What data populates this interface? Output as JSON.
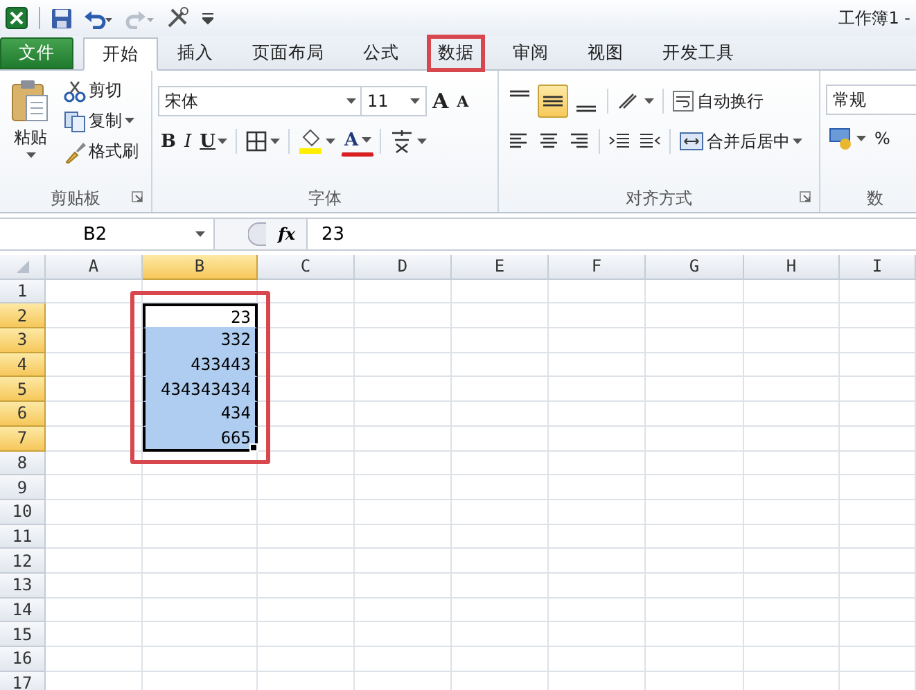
{
  "title_bar": {
    "title": "工作簿1 -"
  },
  "tabs": [
    {
      "label": "文件",
      "kind": "file",
      "selected": false,
      "highlighted": false
    },
    {
      "label": "开始",
      "kind": "tab",
      "selected": true,
      "highlighted": false
    },
    {
      "label": "插入",
      "kind": "tab",
      "selected": false,
      "highlighted": false
    },
    {
      "label": "页面布局",
      "kind": "tab",
      "selected": false,
      "highlighted": false
    },
    {
      "label": "公式",
      "kind": "tab",
      "selected": false,
      "highlighted": false
    },
    {
      "label": "数据",
      "kind": "tab",
      "selected": false,
      "highlighted": true
    },
    {
      "label": "审阅",
      "kind": "tab",
      "selected": false,
      "highlighted": false
    },
    {
      "label": "视图",
      "kind": "tab",
      "selected": false,
      "highlighted": false
    },
    {
      "label": "开发工具",
      "kind": "tab",
      "selected": false,
      "highlighted": false
    }
  ],
  "ribbon": {
    "clipboard": {
      "label": "剪贴板",
      "paste": "粘贴",
      "cut": "剪切",
      "copy": "复制",
      "format_painter": "格式刷"
    },
    "font": {
      "label": "字体",
      "font_name": "宋体",
      "font_size": "11",
      "grow": "A",
      "shrink": "A",
      "bold": "B",
      "italic": "I",
      "underline": "U",
      "font_color": "A"
    },
    "alignment": {
      "label": "对齐方式",
      "wrap_text": "自动换行",
      "merge_center": "合并后居中",
      "vertical_align": [
        {
          "selected": false
        },
        {
          "selected": true
        },
        {
          "selected": false
        }
      ]
    },
    "number": {
      "label": "数",
      "format": "常规",
      "percent": "%"
    }
  },
  "formula_bar": {
    "name_box": "B2",
    "function_label": "fx",
    "value": "23"
  },
  "columns": [
    {
      "label": "A",
      "selected": false
    },
    {
      "label": "B",
      "selected": true
    },
    {
      "label": "C",
      "selected": false
    },
    {
      "label": "D",
      "selected": false
    },
    {
      "label": "E",
      "selected": false
    },
    {
      "label": "F",
      "selected": false
    },
    {
      "label": "G",
      "selected": false
    },
    {
      "label": "H",
      "selected": false
    },
    {
      "label": "I",
      "selected": false
    }
  ],
  "rows": [
    {
      "header": "1",
      "kind": "plain"
    },
    {
      "header": "2",
      "kind": "active",
      "value": "23"
    },
    {
      "header": "3",
      "kind": "selected",
      "value": "332"
    },
    {
      "header": "4",
      "kind": "selected",
      "value": "433443"
    },
    {
      "header": "5",
      "kind": "selected",
      "value": "434343434"
    },
    {
      "header": "6",
      "kind": "selected",
      "value": "434"
    },
    {
      "header": "7",
      "kind": "selected",
      "value": "665"
    },
    {
      "header": "8",
      "kind": "plain"
    },
    {
      "header": "9",
      "kind": "plain"
    },
    {
      "header": "10",
      "kind": "plain"
    },
    {
      "header": "11",
      "kind": "plain"
    },
    {
      "header": "12",
      "kind": "plain"
    },
    {
      "header": "13",
      "kind": "plain"
    },
    {
      "header": "14",
      "kind": "plain"
    },
    {
      "header": "15",
      "kind": "plain"
    },
    {
      "header": "16",
      "kind": "plain"
    },
    {
      "header": "17",
      "kind": "plain"
    }
  ],
  "selection": {
    "highlighted": true
  }
}
